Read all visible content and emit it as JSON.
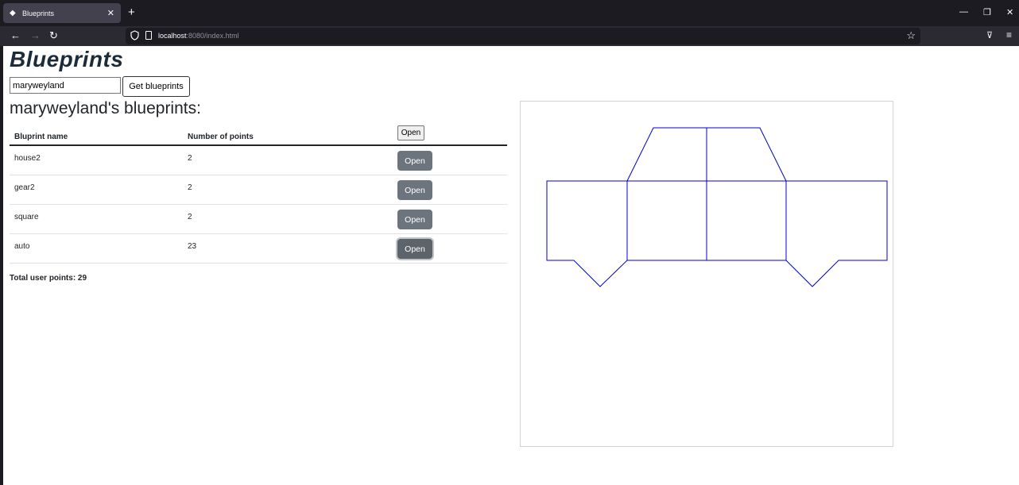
{
  "browser": {
    "tab_title": "Blueprints",
    "url_host": "localhost",
    "url_rest": ":8080/index.html"
  },
  "page": {
    "title": "Blueprints",
    "author_input_value": "maryweyland",
    "get_button_label": "Get blueprints",
    "subtitle": "maryweyland's blueprints:"
  },
  "table": {
    "headers": [
      "Bluprint name",
      "Number of points"
    ],
    "header_button_label": "Open",
    "rows": [
      {
        "name": "house2",
        "points": "2",
        "button": "Open"
      },
      {
        "name": "gear2",
        "points": "2",
        "button": "Open"
      },
      {
        "name": "square",
        "points": "2",
        "button": "Open"
      },
      {
        "name": "auto",
        "points": "23",
        "button": "Open"
      }
    ],
    "total_label": "Total user points: 29"
  },
  "canvas": {
    "stroke_color": "#0000cc"
  },
  "colors": {
    "open_button": "#6c757d",
    "title": "#1c2b3a"
  }
}
